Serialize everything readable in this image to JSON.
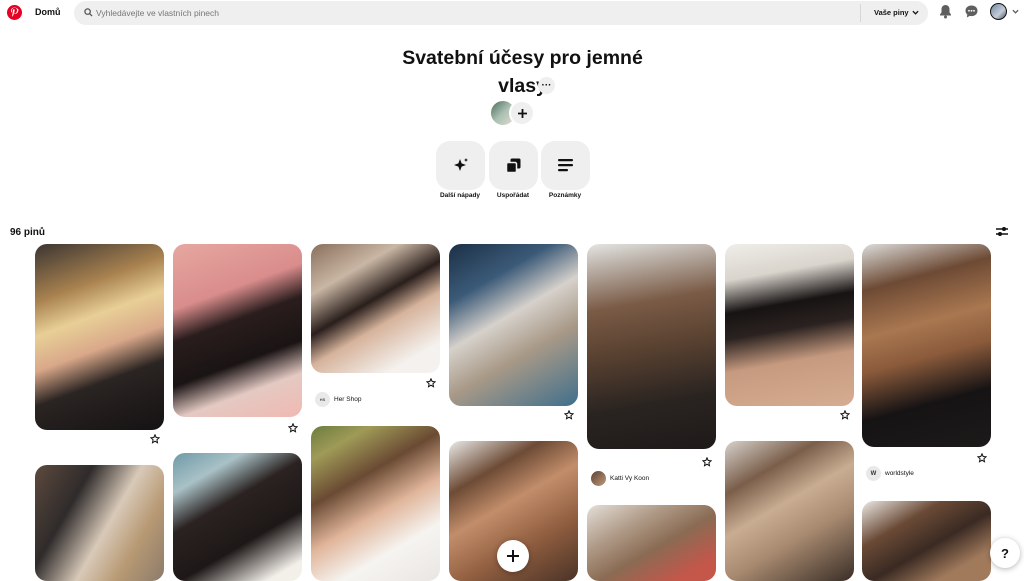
{
  "header": {
    "home_label": "Domů",
    "search_placeholder": "Vyhledávejte ve vlastních pinech",
    "search_scope": "Vaše piny"
  },
  "board": {
    "title": "Svatební účesy pro jemné vlasy",
    "more_label": "···",
    "tools": [
      {
        "label": "Další nápady",
        "icon": "sparkle-icon"
      },
      {
        "label": "Uspořádat",
        "icon": "organize-icon"
      },
      {
        "label": "Poznámky",
        "icon": "notes-icon"
      }
    ]
  },
  "pin_count": "96 pinů",
  "pins": {
    "p3": {
      "source": "Her Shop"
    },
    "p5": {
      "source": "Katti Vy Koon"
    },
    "p7": {
      "source": "worldstyle",
      "avatar_letter": "W"
    }
  },
  "help_label": "?",
  "colors": {
    "brand": "#e60023",
    "surface": "#efefef"
  }
}
